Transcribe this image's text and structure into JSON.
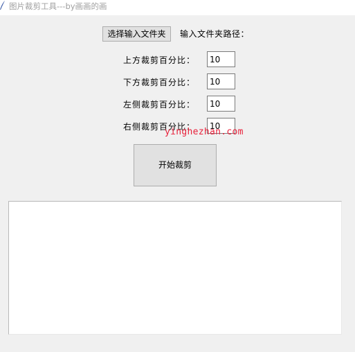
{
  "window": {
    "title": "图片裁剪工具---by画画的画"
  },
  "toolbar": {
    "select_folder_label": "选择输入文件夹",
    "folder_path_label": "输入文件夹路径："
  },
  "crop": {
    "top_label": "上方裁剪百分比：",
    "top_value": "10",
    "bottom_label": "下方裁剪百分比：",
    "bottom_value": "10",
    "left_label": "左侧裁剪百分比：",
    "left_value": "10",
    "right_label": "右侧裁剪百分比：",
    "right_value": "10"
  },
  "actions": {
    "start_label": "开始裁剪"
  },
  "log": {
    "value": ""
  },
  "watermark": {
    "text": "yinghezhan.com"
  },
  "colors": {
    "background": "#f0f0f0",
    "button": "#e1e1e1",
    "watermark": "#e8203a"
  },
  "icons": {
    "app_icon": "feather-pen-icon"
  }
}
